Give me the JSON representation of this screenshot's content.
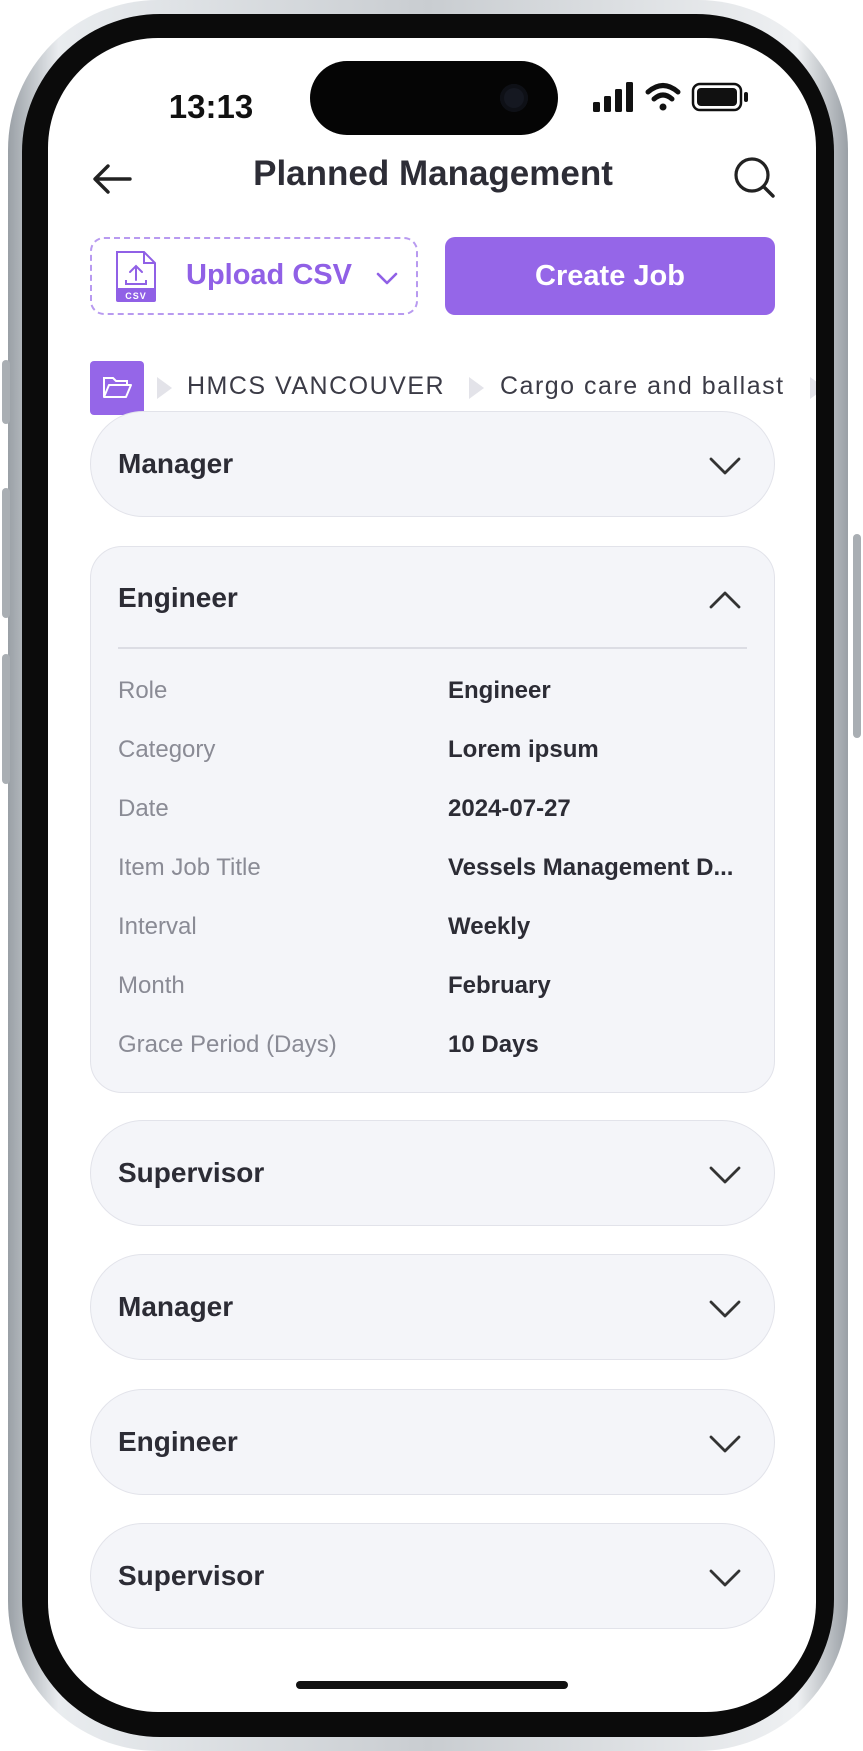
{
  "status_bar": {
    "time": "13:13"
  },
  "header": {
    "title": "Planned Management"
  },
  "actions": {
    "upload_csv_label": "Upload CSV",
    "csv_icon_text": "CSV",
    "create_job_label": "Create Job"
  },
  "breadcrumb": {
    "items": [
      "HMCS VANCOUVER",
      "Cargo care and ballast"
    ]
  },
  "accordion": {
    "items": [
      {
        "title": "Manager",
        "expanded": false
      },
      {
        "title": "Engineer",
        "expanded": true,
        "details": [
          {
            "label": "Role",
            "value": "Engineer"
          },
          {
            "label": "Category",
            "value": "Lorem ipsum"
          },
          {
            "label": "Date",
            "value": "2024-07-27"
          },
          {
            "label": "Item Job Title",
            "value": "Vessels Management D..."
          },
          {
            "label": "Interval",
            "value": "Weekly"
          },
          {
            "label": "Month",
            "value": "February"
          },
          {
            "label": "Grace Period (Days)",
            "value": "10 Days"
          }
        ]
      },
      {
        "title": "Supervisor",
        "expanded": false
      },
      {
        "title": "Manager",
        "expanded": false
      },
      {
        "title": "Engineer",
        "expanded": false
      },
      {
        "title": "Supervisor",
        "expanded": false
      }
    ]
  },
  "colors": {
    "accent": "#9566e8",
    "card_bg": "#f4f5f9"
  }
}
